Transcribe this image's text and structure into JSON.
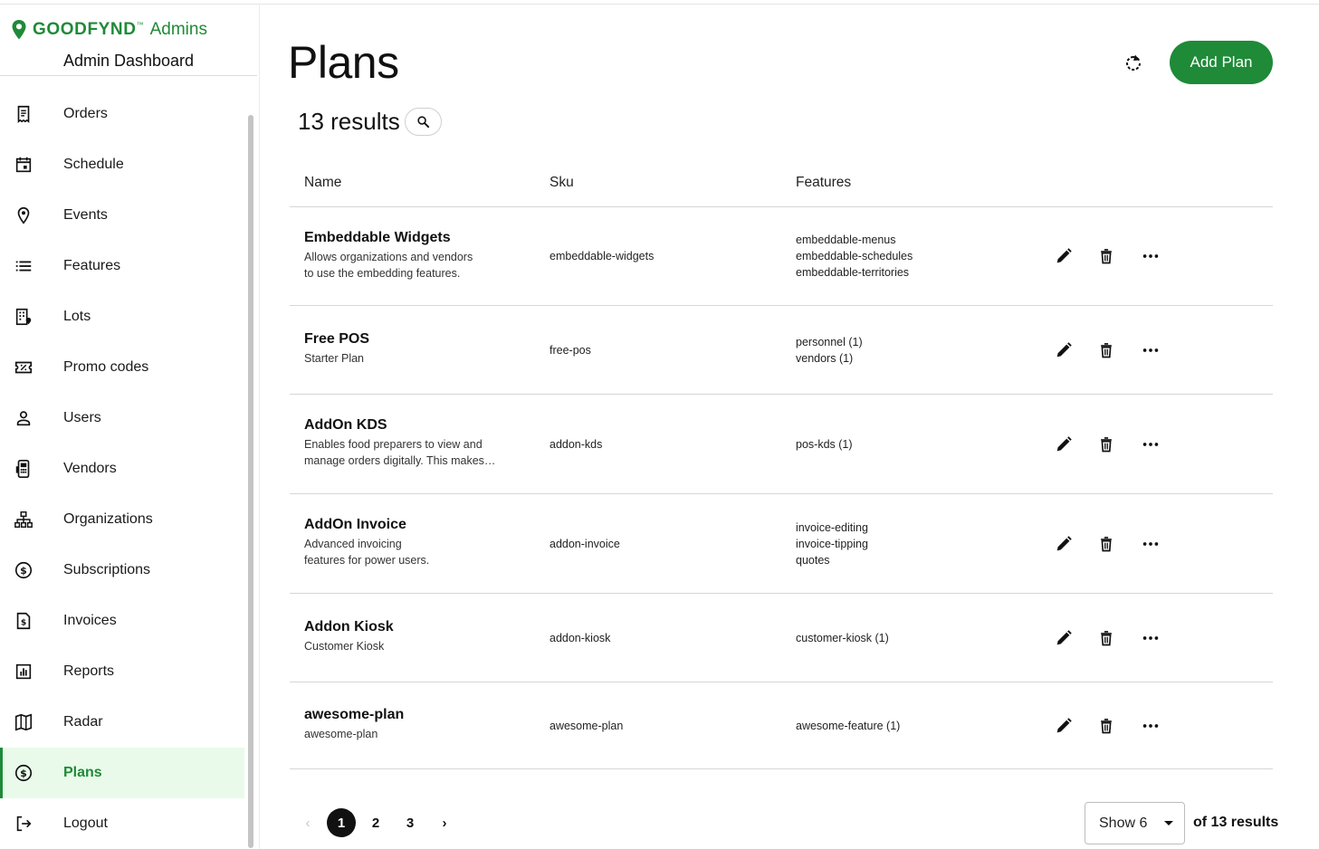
{
  "brand": {
    "name": "GOODFYND",
    "tm": "™",
    "sub": "Admins"
  },
  "sidebar": {
    "title": "Admin Dashboard",
    "items": [
      {
        "label": "Orders",
        "icon": "receipt-icon",
        "active": false
      },
      {
        "label": "Schedule",
        "icon": "calendar-icon",
        "active": false
      },
      {
        "label": "Events",
        "icon": "location-pin-icon",
        "active": false
      },
      {
        "label": "Features",
        "icon": "list-icon",
        "active": false
      },
      {
        "label": "Lots",
        "icon": "building-pin-icon",
        "active": false
      },
      {
        "label": "Promo codes",
        "icon": "ticket-icon",
        "active": false
      },
      {
        "label": "Users",
        "icon": "person-icon",
        "active": false
      },
      {
        "label": "Vendors",
        "icon": "pos-terminal-icon",
        "active": false
      },
      {
        "label": "Organizations",
        "icon": "org-chart-icon",
        "active": false
      },
      {
        "label": "Subscriptions",
        "icon": "dollar-circle-icon",
        "active": false
      },
      {
        "label": "Invoices",
        "icon": "invoice-icon",
        "active": false
      },
      {
        "label": "Reports",
        "icon": "bar-chart-icon",
        "active": false
      },
      {
        "label": "Radar",
        "icon": "map-icon",
        "active": false
      },
      {
        "label": "Plans",
        "icon": "dollar-circle-icon",
        "active": true
      },
      {
        "label": "Logout",
        "icon": "logout-icon",
        "active": false
      }
    ]
  },
  "header": {
    "title": "Plans",
    "results": "13 results",
    "add_label": "Add Plan"
  },
  "table": {
    "columns": [
      "Name",
      "Sku",
      "Features"
    ],
    "rows": [
      {
        "name": "Embeddable Widgets",
        "desc": [
          "Allows organizations and vendors",
          "to use the embedding features."
        ],
        "sku": "embeddable-widgets",
        "features": [
          "embeddable-menus",
          "embeddable-schedules",
          "embeddable-territories"
        ]
      },
      {
        "name": "Free POS",
        "desc": [
          "Starter Plan"
        ],
        "sku": "free-pos",
        "features": [
          "personnel (1)",
          "vendors (1)"
        ]
      },
      {
        "name": "AddOn KDS",
        "desc": [
          "Enables food preparers to view and",
          "manage orders digitally. This makes…"
        ],
        "sku": "addon-kds",
        "features": [
          "pos-kds (1)"
        ]
      },
      {
        "name": "AddOn Invoice",
        "desc": [
          "Advanced invoicing",
          "features for power users."
        ],
        "sku": "addon-invoice",
        "features": [
          "invoice-editing",
          "invoice-tipping",
          "quotes"
        ]
      },
      {
        "name": "Addon Kiosk",
        "desc": [
          "Customer Kiosk"
        ],
        "sku": "addon-kiosk",
        "features": [
          "customer-kiosk (1)"
        ]
      },
      {
        "name": "awesome-plan",
        "desc": [
          "awesome-plan"
        ],
        "sku": "awesome-plan",
        "features": [
          "awesome-feature (1)"
        ]
      }
    ]
  },
  "pagination": {
    "prev": "‹",
    "pages": [
      "1",
      "2",
      "3"
    ],
    "current": "1",
    "next": "›",
    "show_label": "Show 6",
    "of_results": "of 13 results"
  },
  "colors": {
    "brand": "#1f8a38",
    "active_bg": "#e9faea"
  }
}
